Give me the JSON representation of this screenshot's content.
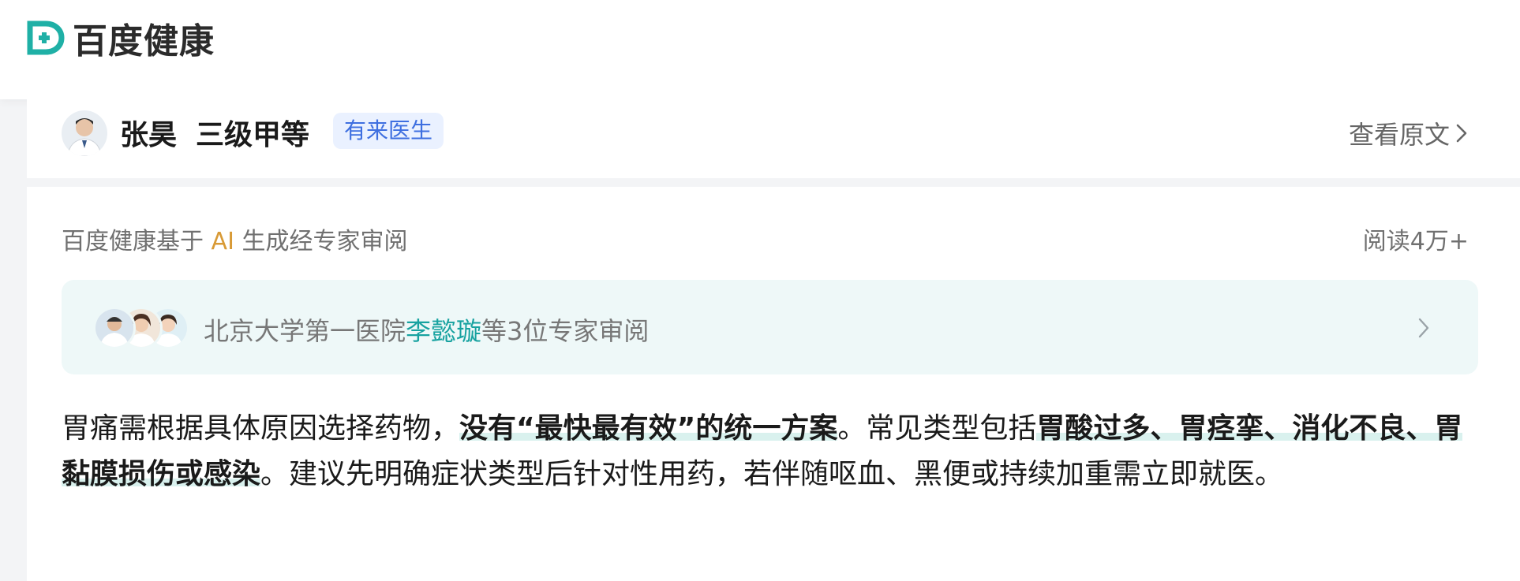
{
  "header": {
    "brand_name": "百度健康",
    "brand_color": "#1fb0a6"
  },
  "doctor_card": {
    "name": "张昊",
    "hospital_level": "三级甲等",
    "source_badge": "有来医生",
    "view_original": "查看原文",
    "chevron_icon": "chevron-right-icon"
  },
  "answer_card": {
    "ai_note_prefix": "百度健康基于 ",
    "ai_label": "AI",
    "ai_note_suffix": " 生成经专家审阅",
    "read_count": "阅读4万+",
    "review": {
      "prefix": "北京大学第一医院",
      "expert": "李懿璇",
      "suffix": "等3位专家审阅",
      "chevron_icon": "chevron-right-icon"
    },
    "answer_segments": [
      {
        "text": "胃痛需根据具体原因选择药物，",
        "bold": false
      },
      {
        "text": "没有“最快最有效”的统一方案",
        "bold": true
      },
      {
        "text": "。常见类型包括",
        "bold": false
      },
      {
        "text": "胃酸过多、胃痉挛、消化不良、胃黏膜损伤或感染",
        "bold": true
      },
      {
        "text": "。建议先明确症状类型后针对性用药，若伴随呕血、黑便或持续加重需立即就医。",
        "bold": false
      }
    ]
  }
}
